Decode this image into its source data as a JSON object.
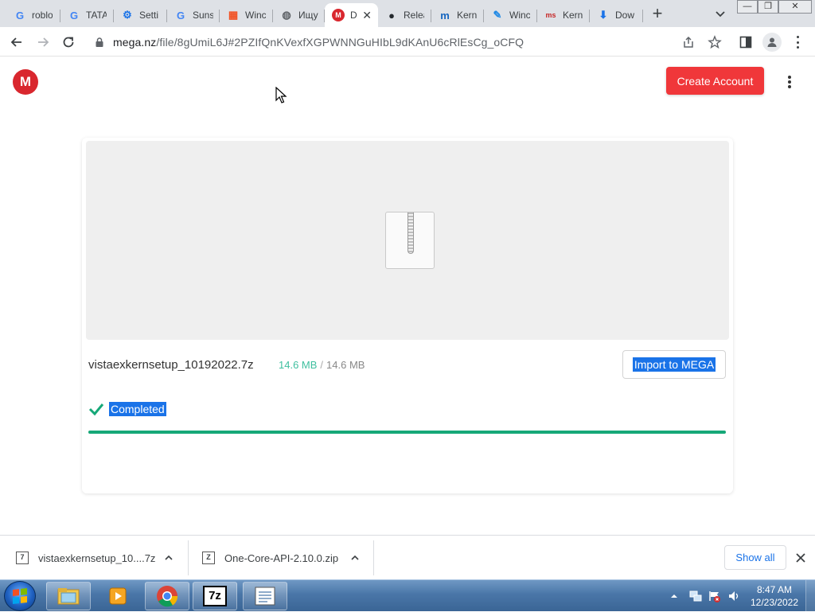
{
  "browser": {
    "tabs": [
      {
        "title": "roblo",
        "favicon": "google-g-icon"
      },
      {
        "title": "TATA",
        "favicon": "google-g-icon"
      },
      {
        "title": "Setti",
        "favicon": "chrome-settings-icon"
      },
      {
        "title": "Suns",
        "favicon": "google-g-icon"
      },
      {
        "title": "Winc",
        "favicon": "microsoft-logo-icon"
      },
      {
        "title": "Ищу",
        "favicon": "globe-icon"
      },
      {
        "title": "D",
        "favicon": "mega-logo-icon",
        "active": true
      },
      {
        "title": "Relea",
        "favicon": "github-icon"
      },
      {
        "title": "Kern",
        "favicon": "m-square-icon"
      },
      {
        "title": "Winc",
        "favicon": "edit-pen-icon"
      },
      {
        "title": "Kern",
        "favicon": "ms-logo-icon"
      },
      {
        "title": "Dow",
        "favicon": "download-icon"
      }
    ],
    "url_host": "mega.nz",
    "url_path": "/file/8gUmiL6J#2PZIfQnKVexfXGPWNNGuHIbL9dKAnU6cRlEsCg_oCFQ"
  },
  "page": {
    "create_account": "Create Account",
    "file_name": "vistaexkernsetup_10192022.7z",
    "downloaded_size": "14.6 MB",
    "size_separator": "/",
    "total_size": "14.6 MB",
    "import_button": "Import to MEGA",
    "status": "Completed",
    "progress_percent": 100
  },
  "downloads": {
    "items": [
      {
        "name": "vistaexkernsetup_10....7z",
        "icon": "7z-archive-icon"
      },
      {
        "name": "One-Core-API-2.10.0.zip",
        "icon": "zip-archive-icon"
      }
    ],
    "show_all": "Show all"
  },
  "taskbar": {
    "time": "8:47 AM",
    "date": "12/23/2022",
    "pinned": [
      "file-explorer-icon",
      "media-player-icon",
      "chrome-icon",
      "7zip-icon",
      "notepad-icon"
    ]
  },
  "colors": {
    "mega_red": "#d9272e",
    "create_btn": "#f0373a",
    "progress": "#16a878",
    "size_green": "#3fbf9f",
    "selection": "#1a73e8"
  }
}
